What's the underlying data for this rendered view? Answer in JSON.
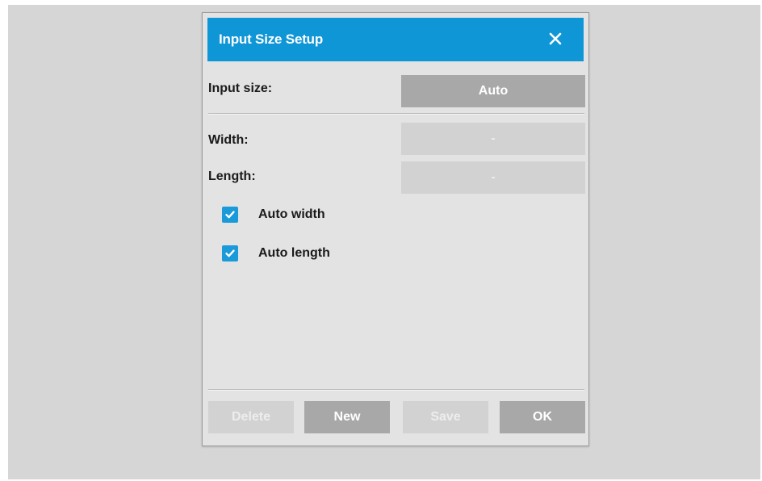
{
  "dialog": {
    "title": "Input Size Setup",
    "close_icon": "close-icon"
  },
  "input_size": {
    "label": "Input size:",
    "value": "Auto"
  },
  "width": {
    "label": "Width:",
    "value": "-"
  },
  "length": {
    "label": "Length:",
    "value": "-"
  },
  "checkboxes": [
    {
      "label": "Auto width",
      "checked": true
    },
    {
      "label": "Auto length",
      "checked": true
    }
  ],
  "buttons": {
    "delete": "Delete",
    "new": "New",
    "save": "Save",
    "ok": "OK"
  },
  "colors": {
    "titlebar": "#0f96d6",
    "checkbox": "#1a9ad9",
    "button_active": "#a8a8a8",
    "button_disabled": "#d2d2d2",
    "dialog_bg": "#e3e3e3",
    "backdrop": "#d6d6d6"
  }
}
